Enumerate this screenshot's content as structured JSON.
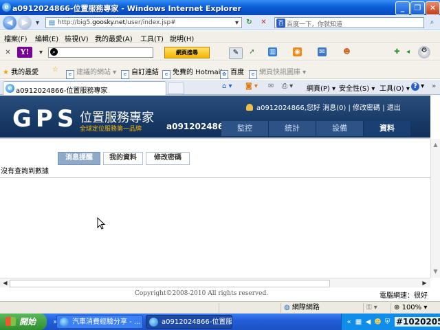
{
  "window": {
    "title": "a0912024866-位置服務專家 - Windows Internet Explorer"
  },
  "address_bar": {
    "url_gray_prefix": "http://big5.",
    "url_domain": "goosky.net",
    "url_suffix": "/user/index.jsp#",
    "search_placeholder": "百度一下，你就知道"
  },
  "menu": {
    "items": [
      "檔案(F)",
      "編輯(E)",
      "檢視(V)",
      "我的最愛(A)",
      "工具(T)",
      "說明(H)"
    ]
  },
  "yahoo_toolbar": {
    "logo_text": "Y!",
    "web_search_button": "網頁搜尋"
  },
  "favorites_bar": {
    "label": "我的最愛",
    "items": [
      "建議的網站",
      "自訂連結",
      "免費的 Hotmail",
      "百度",
      "網頁快訊圖庫"
    ]
  },
  "tab": {
    "title": "a0912024866-位置服務專家"
  },
  "command_bar": {
    "page": "網頁(P)",
    "safety": "安全性(S)",
    "tools": "工具(O)"
  },
  "site": {
    "logo": "GPS",
    "brand": "位置服務專家",
    "slogan": "全球定位服務第一品牌",
    "account": "a0912024866",
    "user_greeting": "a0912024866,您好",
    "messages": "消息(0)",
    "change_password_link": "修改密碼",
    "logout": "退出",
    "nav_tabs": [
      "監控",
      "統計",
      "設備",
      "資料"
    ],
    "active_nav": "資料",
    "sub_tabs": [
      "消息提醒",
      "我的資料",
      "修改密碼"
    ],
    "active_sub_tab": "消息提醒",
    "no_data_message": "沒有查詢到數據",
    "copyright": "Copyright©2008-2010 All rights reserved.",
    "network_speed": "電腦網速：很好"
  },
  "status_bar": {
    "zone": "網際網路",
    "zoom": "100%"
  },
  "taskbar": {
    "start": "開始",
    "buttons": [
      "汽車消費經驗分享 - ...",
      "a0912024866-位置服..."
    ],
    "post_number": "#1020205"
  },
  "colors": {
    "banner": "#1c3e6c",
    "accent_orange": "#f7b500",
    "titlebar": "#0a5fd8"
  }
}
